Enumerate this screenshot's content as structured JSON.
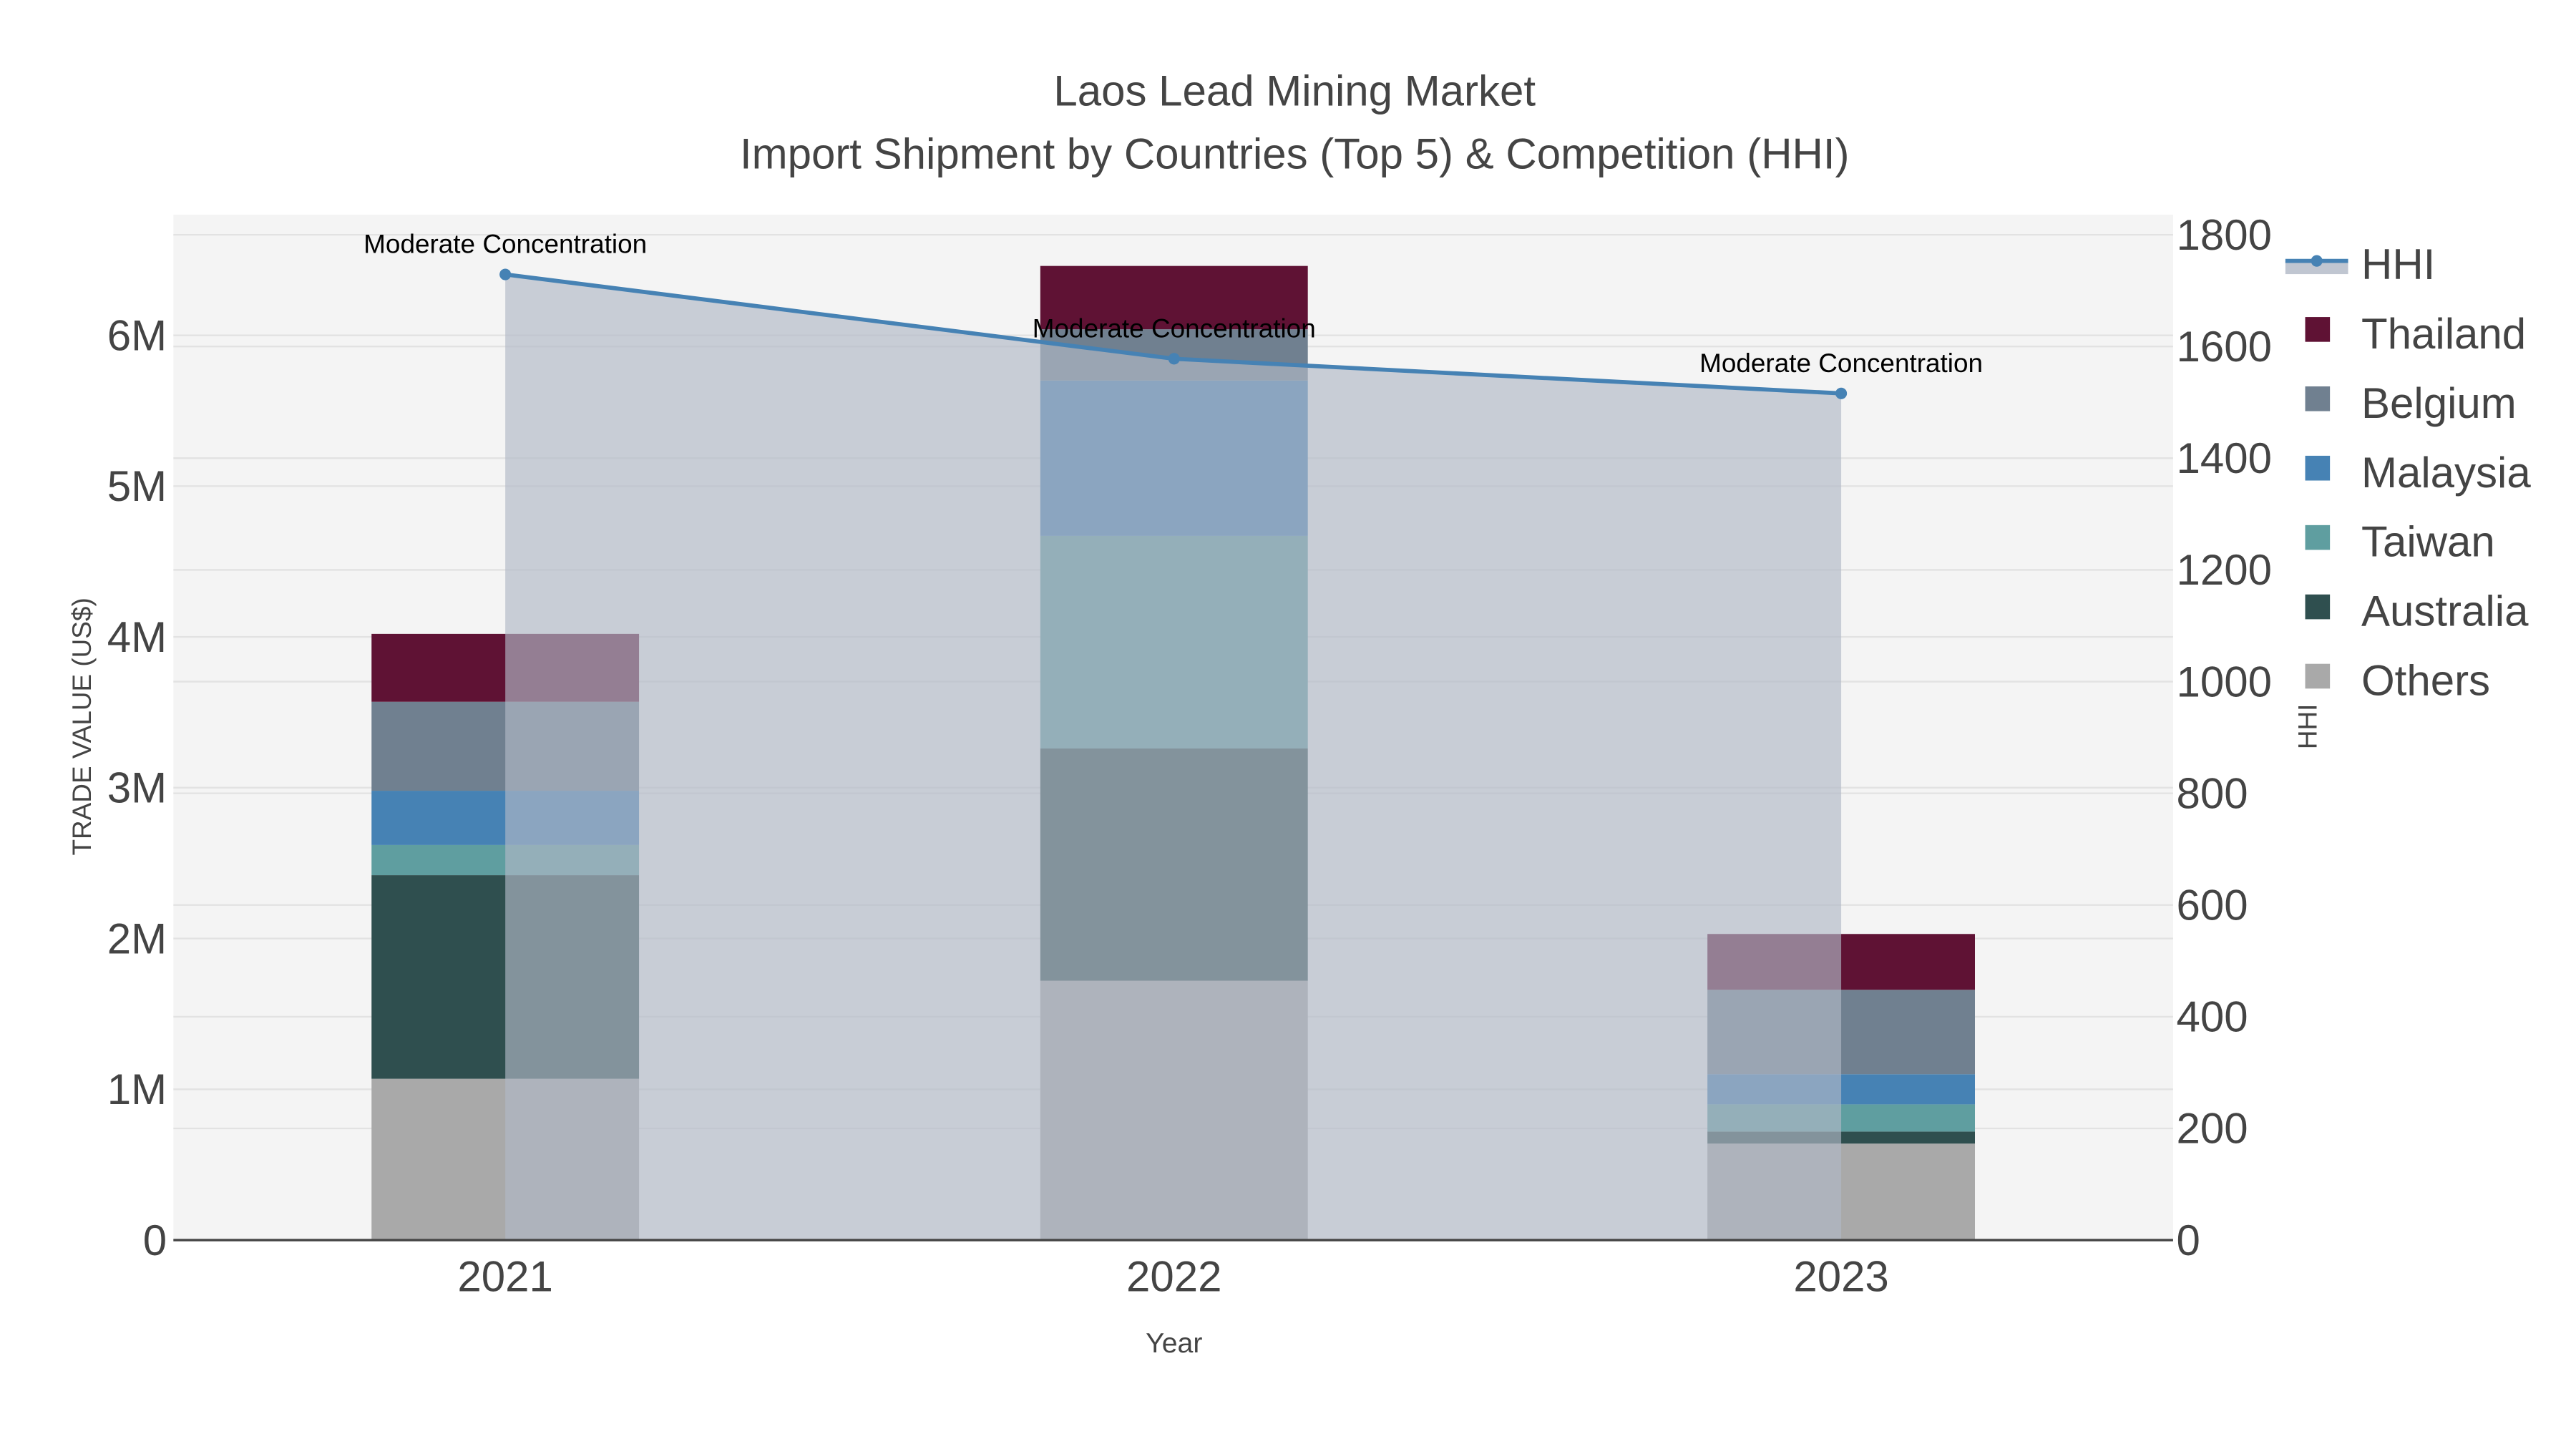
{
  "chart_data": {
    "type": "bar",
    "title": "Laos Lead Mining Market",
    "subtitle": "Import Shipment by Countries (Top 5) & Competition (HHI)",
    "xlabel": "Year",
    "ylabel": "TRADE VALUE (US$)",
    "y2label": "HHI",
    "categories": [
      "2021",
      "2022",
      "2023"
    ],
    "ylim": [
      0,
      6800000
    ],
    "y2lim": [
      0,
      1836
    ],
    "yticks": [
      {
        "v": 0,
        "label": "0"
      },
      {
        "v": 1000000,
        "label": "1M"
      },
      {
        "v": 2000000,
        "label": "2M"
      },
      {
        "v": 3000000,
        "label": "3M"
      },
      {
        "v": 4000000,
        "label": "4M"
      },
      {
        "v": 5000000,
        "label": "5M"
      },
      {
        "v": 6000000,
        "label": "6M"
      }
    ],
    "y2ticks": [
      0,
      200,
      400,
      600,
      800,
      1000,
      1200,
      1400,
      1600,
      1800
    ],
    "stacked": true,
    "series": [
      {
        "name": "Others",
        "color": "#a9a9a9",
        "values": [
          1070000,
          1720000,
          640000
        ]
      },
      {
        "name": "Australia",
        "color": "#2f4f4f",
        "values": [
          1350000,
          1540000,
          80000
        ]
      },
      {
        "name": "Taiwan",
        "color": "#5f9ea0",
        "values": [
          200000,
          1410000,
          180000
        ]
      },
      {
        "name": "Malaysia",
        "color": "#4682b4",
        "values": [
          360000,
          1030000,
          200000
        ]
      },
      {
        "name": "Belgium",
        "color": "#708090",
        "values": [
          590000,
          340000,
          560000
        ]
      },
      {
        "name": "Thailand",
        "color": "#5f1234",
        "values": [
          450000,
          420000,
          370000
        ]
      }
    ],
    "line": {
      "name": "HHI",
      "color": "#4682b4",
      "values": [
        1729,
        1578,
        1516
      ],
      "annotations": [
        "Moderate Concentration",
        "Moderate Concentration",
        "Moderate Concentration"
      ]
    },
    "legend": {
      "placement": "right",
      "order": [
        "HHI",
        "Thailand",
        "Belgium",
        "Malaysia",
        "Taiwan",
        "Australia",
        "Others"
      ]
    },
    "grid": true
  }
}
